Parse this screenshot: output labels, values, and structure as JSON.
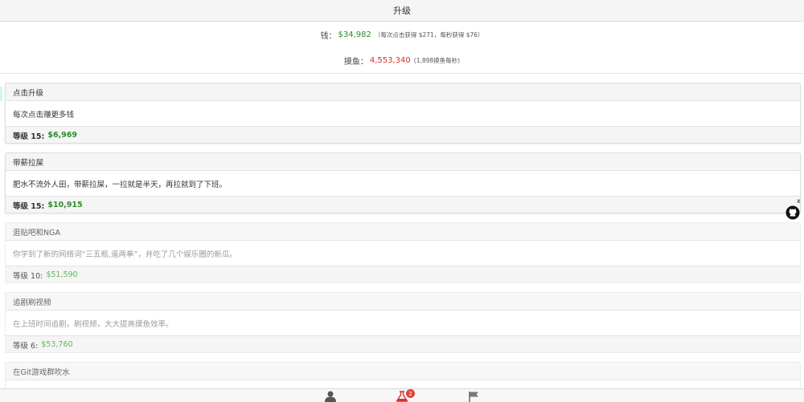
{
  "header": {
    "title": "升级"
  },
  "stats": {
    "money_label": "钱：",
    "money_value": "$34,982",
    "money_note": "（每次点击获得 $271，每秒获得 $76）",
    "fish_label": "摸鱼：",
    "fish_value": "4,553,340",
    "fish_note": "(1,898摸鱼每秒)"
  },
  "upgrades": [
    {
      "title": "点击升级",
      "desc": "每次点击赚更多钱",
      "level_label": "等级 15:",
      "price": "$6,969",
      "state": "affordable"
    },
    {
      "title": "带薪拉屎",
      "desc": "肥水不流外人田，带薪拉屎，一拉就是半天，再拉就到了下班。",
      "level_label": "等级 15:",
      "price": "$10,915",
      "state": "affordable"
    },
    {
      "title": "逛贴吧和NGA",
      "desc": "你学到了新的网络词“三五瓶,遥两拳”，并吃了几个娱乐圈的新瓜。",
      "level_label": "等级 10:",
      "price": "$51,590",
      "state": "locked"
    },
    {
      "title": "追剧刷视频",
      "desc": "在上班时间追剧，刷视频，大大提高摸鱼效率。",
      "level_label": "等级 6:",
      "price": "$53,760",
      "state": "locked"
    },
    {
      "title": "在Git游戏群吹水"
    }
  ],
  "bottom_nav": {
    "items": [
      {
        "icon": "user-icon"
      },
      {
        "icon": "flask-icon",
        "badge": "2"
      },
      {
        "icon": "flag-icon"
      }
    ]
  },
  "github_widget": {
    "close": "x",
    "icon": "github-icon"
  },
  "colors": {
    "money": "#2e8b2e",
    "fish": "#d9312b",
    "price_active": "#2e8b2e",
    "price_locked": "#5cb85c",
    "badge": "#e0433a"
  }
}
